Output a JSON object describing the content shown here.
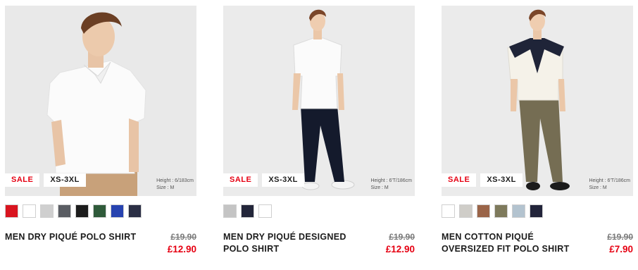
{
  "products": [
    {
      "badge_sale": "SALE",
      "badge_size": "XS-3XL",
      "model_height": "Height : 6/183cm",
      "model_size": "Size : M",
      "title": "MEN DRY PIQUÉ POLO SHIRT",
      "old_price": "£19.90",
      "new_price": "£12.90",
      "image": "model in white polo shirt and beige trousers, close-up",
      "colors": [
        "#d9141f",
        "#ffffff",
        "#cfcfcf",
        "#5a5d63",
        "#1c1c1c",
        "#2f5a3a",
        "#2743b0",
        "#2b2f45"
      ]
    },
    {
      "badge_sale": "SALE",
      "badge_size": "XS-3XL",
      "model_height": "Height : 6'T/186cm",
      "model_size": "Size : M",
      "title": "MEN DRY PIQUÉ DESIGNED POLO SHIRT",
      "old_price": "£19.90",
      "new_price": "£12.90",
      "image": "model in white polo shirt and navy trousers, full length",
      "colors": [
        "#c4c4c4",
        "#23263a",
        "#ffffff"
      ]
    },
    {
      "badge_sale": "SALE",
      "badge_size": "XS-3XL",
      "model_height": "Height : 6'T/186cm",
      "model_size": "Size : M",
      "title": "MEN COTTON PIQUÉ OVERSIZED FIT POLO SHIRT",
      "old_price": "£19.90",
      "new_price": "£7.90",
      "image": "model in off-white polo with navy sweater over shoulders and olive trousers",
      "colors": [
        "#ffffff",
        "#cfcdc8",
        "#9a6448",
        "#7e7a5c",
        "#b3c3cf",
        "#22243a"
      ]
    }
  ]
}
